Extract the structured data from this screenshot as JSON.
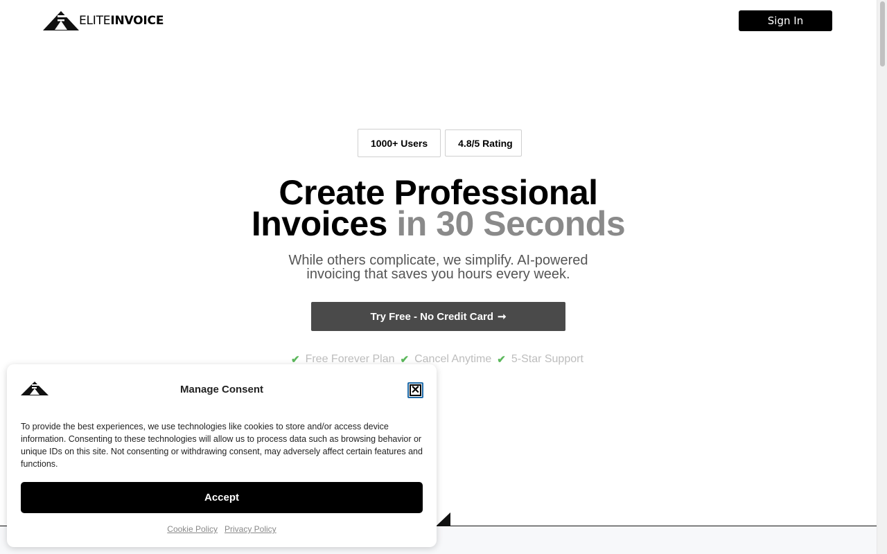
{
  "header": {
    "logo": {
      "part1": "ELITE",
      "part2": "INVOICE"
    },
    "sign_in_label": "Sign In"
  },
  "hero": {
    "badges": [
      "1000+ Users",
      "4.8/5 Rating"
    ],
    "title_line1": "Create Professional",
    "title_line2_black": "Invoices",
    "title_line2_gray": "in 30 Seconds",
    "subtitle_line1": "While others complicate, we simplify. AI-powered",
    "subtitle_line2": "invoicing that saves you hours every week.",
    "cta_label": "Try Free - No Credit Card",
    "cta_arrow": "➞",
    "perks": [
      "Free Forever Plan",
      "Cancel Anytime",
      "5-Star Support"
    ],
    "check_glyph": "✔"
  },
  "consent": {
    "title": "Manage Consent",
    "close_glyph": "✕",
    "body": "To provide the best experiences, we use technologies like cookies to store and/or access device information. Consenting to these technologies will allow us to process data such as browsing behavior or unique IDs on this site. Not consenting or withdrawing consent, may adversely affect certain features and functions.",
    "accept_label": "Accept",
    "links": [
      "Cookie Policy",
      "Privacy Policy"
    ]
  },
  "icons": {
    "logo": "logo-triangle-icon",
    "close": "close-icon",
    "check": "check-icon",
    "arrow": "arrow-right-icon"
  },
  "colors": {
    "primary": "#000000",
    "cta_bg": "#4a4a4a",
    "check_green": "#5cb85c",
    "title_gray": "#8a8a8a"
  }
}
